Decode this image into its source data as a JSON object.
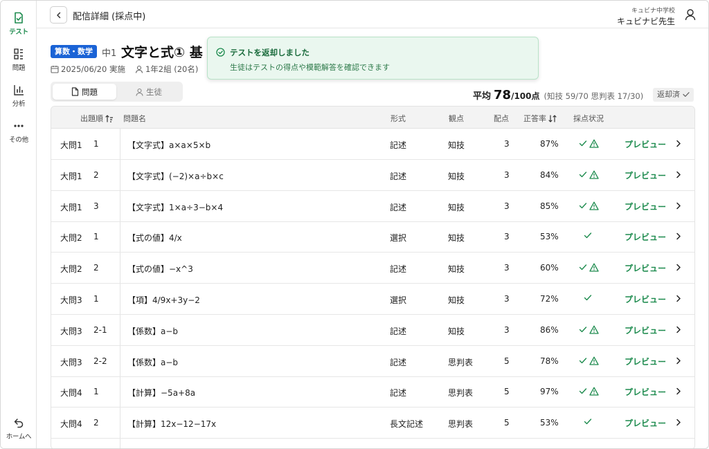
{
  "colors": {
    "accent": "#1d8b4e",
    "badge": "#1a63d6",
    "toast_bg": "#eaf7ef",
    "warning": "#1d8b4e"
  },
  "sidebar": {
    "items": [
      {
        "label": "テスト",
        "icon": "test-icon",
        "active": true
      },
      {
        "label": "問題",
        "icon": "grid-icon",
        "active": false
      },
      {
        "label": "分析",
        "icon": "chart-icon",
        "active": false
      },
      {
        "label": "その他",
        "icon": "more-icon",
        "active": false
      }
    ],
    "home": {
      "label": "ホームへ",
      "icon": "return-icon"
    }
  },
  "header": {
    "title": "配信詳細 (採点中)",
    "school": "キュビナ中学校",
    "teacher": "キュビナビ先生"
  },
  "test": {
    "subject": "算数・数学",
    "grade": "中1",
    "title": "文字と式① 基",
    "date": "2025/06/20 実施",
    "class": "1年2組 (20名)"
  },
  "toast": {
    "title": "テストを返却しました",
    "body": "生徒はテストの得点や模範解答を確認できます"
  },
  "tabs": [
    {
      "label": "問題",
      "icon": "document-icon"
    },
    {
      "label": "生徒",
      "icon": "person-icon"
    }
  ],
  "stats": {
    "label": "平均",
    "average": "78",
    "unit": "/100点",
    "breakdown": "(知技 59/70  思判表 17/30)",
    "returned": "返却済"
  },
  "table": {
    "headers": {
      "order": "出題順",
      "name": "問題名",
      "format": "形式",
      "perspective": "観点",
      "points": "配点",
      "rate": "正答率",
      "status": "採点状況"
    },
    "preview_label": "プレビュー",
    "rows": [
      {
        "section": "大問1",
        "num": "1",
        "name": "【文字式】a×a×5×b",
        "format": "記述",
        "perspective": "知技",
        "points": "3",
        "rate": "87%",
        "warning": true
      },
      {
        "section": "大問1",
        "num": "2",
        "name": "【文字式】(−2)×a÷b×c",
        "format": "記述",
        "perspective": "知技",
        "points": "3",
        "rate": "84%",
        "warning": true
      },
      {
        "section": "大問1",
        "num": "3",
        "name": "【文字式】1×a÷3−b×4",
        "format": "記述",
        "perspective": "知技",
        "points": "3",
        "rate": "85%",
        "warning": true
      },
      {
        "section": "大問2",
        "num": "1",
        "name": "【式の値】4/x",
        "format": "選択",
        "perspective": "知技",
        "points": "3",
        "rate": "53%",
        "warning": false
      },
      {
        "section": "大問2",
        "num": "2",
        "name": "【式の値】−x^3",
        "format": "記述",
        "perspective": "知技",
        "points": "3",
        "rate": "60%",
        "warning": true
      },
      {
        "section": "大問3",
        "num": "1",
        "name": "【項】4/9x+3y−2",
        "format": "選択",
        "perspective": "知技",
        "points": "3",
        "rate": "72%",
        "warning": false
      },
      {
        "section": "大問3",
        "num": "2-1",
        "name": "【係数】a−b",
        "format": "記述",
        "perspective": "知技",
        "points": "3",
        "rate": "86%",
        "warning": true
      },
      {
        "section": "大問3",
        "num": "2-2",
        "name": "【係数】a−b",
        "format": "記述",
        "perspective": "思判表",
        "points": "5",
        "rate": "78%",
        "warning": true
      },
      {
        "section": "大問4",
        "num": "1",
        "name": "【計算】−5a+8a",
        "format": "記述",
        "perspective": "思判表",
        "points": "5",
        "rate": "97%",
        "warning": true
      },
      {
        "section": "大問4",
        "num": "2",
        "name": "【計算】12x−12−17x",
        "format": "長文記述",
        "perspective": "思判表",
        "points": "5",
        "rate": "53%",
        "warning": false
      }
    ]
  }
}
